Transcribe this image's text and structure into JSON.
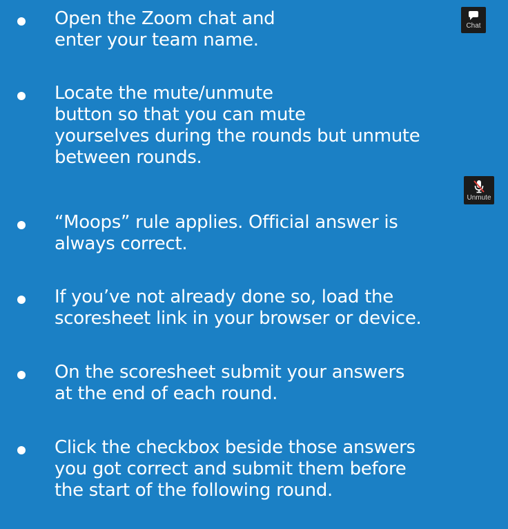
{
  "colors": {
    "background": "#1b80c5",
    "text": "#ffffff",
    "button_background": "#1b1b1b",
    "mute_slash": "#e0403a"
  },
  "bullets": [
    {
      "text": "Open the Zoom chat and\nenter your team name."
    },
    {
      "text": "Locate the mute/unmute\nbutton so that you can mute\nyourselves during the rounds but unmute\nbetween rounds."
    },
    {
      "text": "“Moops” rule applies.  Official answer is\nalways correct."
    },
    {
      "text": "If you’ve not already done so, load the\nscoresheet link in your browser or device."
    },
    {
      "text": "On the scoresheet submit your answers\nat the end of each round."
    },
    {
      "text": "Click the checkbox beside those answers\nyou got correct and submit them before\nthe start of the following round."
    }
  ],
  "chat_button": {
    "icon": "speech-bubble-icon",
    "label": "Chat"
  },
  "unmute_button": {
    "icon": "muted-microphone-icon",
    "label": "Unmute"
  }
}
